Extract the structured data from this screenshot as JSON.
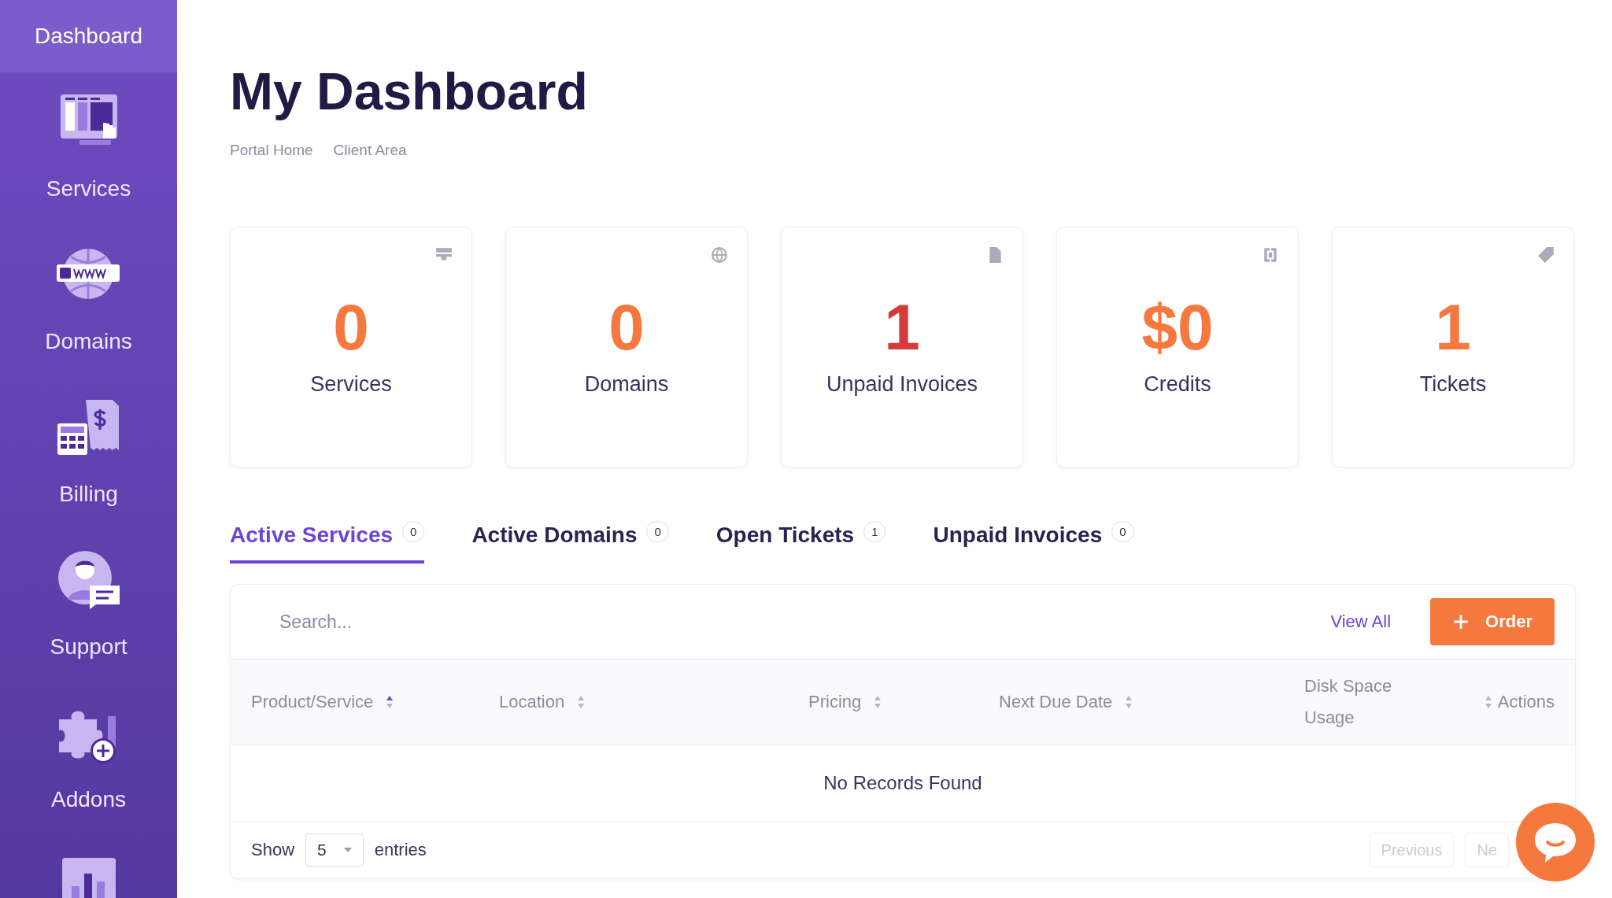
{
  "sidebar": {
    "header": "Dashboard",
    "items": [
      {
        "kind": "link",
        "label": "Services"
      },
      {
        "kind": "link",
        "label": "Domains"
      },
      {
        "kind": "link",
        "label": "Billing"
      },
      {
        "kind": "link",
        "label": "Support"
      },
      {
        "kind": "link",
        "label": "Addons"
      },
      {
        "kind": "cut"
      }
    ]
  },
  "page": {
    "title": "My Dashboard",
    "breadcrumb": [
      "Portal Home",
      "Client Area"
    ]
  },
  "stats": [
    {
      "value": "0",
      "label": "Services",
      "color": "#f5783e"
    },
    {
      "value": "0",
      "label": "Domains",
      "color": "#f5783e"
    },
    {
      "value": "1",
      "label": "Unpaid Invoices",
      "color": "#d63a3a"
    },
    {
      "value": "$0",
      "label": "Credits",
      "color": "#f5783e"
    },
    {
      "value": "1",
      "label": "Tickets",
      "color": "#f5783e"
    }
  ],
  "tabs": [
    {
      "label": "Active Services",
      "count": "0",
      "selected": true
    },
    {
      "label": "Active Domains",
      "count": "0",
      "selected": false
    },
    {
      "label": "Open Tickets",
      "count": "1",
      "selected": false
    },
    {
      "label": "Unpaid Invoices",
      "count": "0",
      "selected": false
    }
  ],
  "panel": {
    "search": {
      "placeholder": "Search..."
    },
    "view_all": "View All",
    "order_button": "Order",
    "columns": [
      {
        "label": "Product/Service",
        "sorted": true
      },
      {
        "label": "Location",
        "sorted": false
      },
      {
        "label": "Pricing",
        "sorted": false
      },
      {
        "label": "Next Due Date",
        "sorted": false
      },
      {
        "label": "Disk Space Usage",
        "sorted": false
      },
      {
        "label": "Actions"
      }
    ],
    "empty_message": "No Records Found",
    "footer": {
      "show": "Show",
      "page_size": "5",
      "entries": "entries",
      "previous": "Previous",
      "next": "Ne"
    }
  }
}
